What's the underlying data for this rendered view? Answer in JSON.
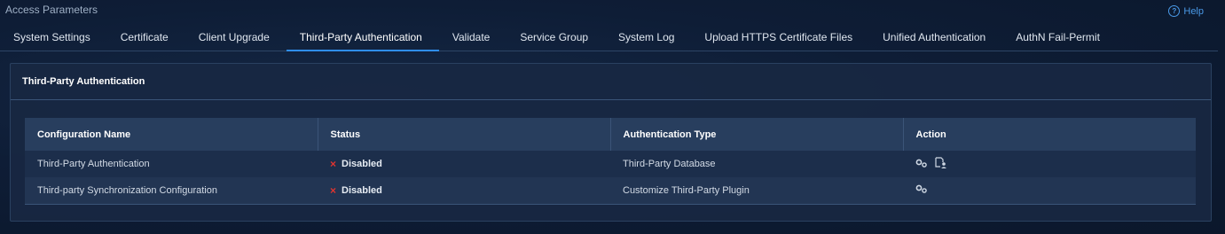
{
  "page": {
    "title": "Access Parameters",
    "help_label": "Help",
    "help_icon_glyph": "?"
  },
  "tabs": [
    {
      "label": "System Settings"
    },
    {
      "label": "Certificate"
    },
    {
      "label": "Client Upgrade"
    },
    {
      "label": "Third-Party Authentication",
      "active": true
    },
    {
      "label": "Validate"
    },
    {
      "label": "Service Group"
    },
    {
      "label": "System Log"
    },
    {
      "label": "Upload HTTPS Certificate Files"
    },
    {
      "label": "Unified Authentication"
    },
    {
      "label": "AuthN Fail-Permit"
    }
  ],
  "panel": {
    "title": "Third-Party Authentication"
  },
  "table": {
    "headers": [
      "Configuration Name",
      "Status",
      "Authentication Type",
      "Action"
    ],
    "rows": [
      {
        "name": "Third-Party Authentication",
        "status_icon": "×",
        "status": "Disabled",
        "auth_type": "Third-Party Database",
        "actions": [
          "settings-icon",
          "user-import-icon"
        ]
      },
      {
        "name": "Third-party Synchronization Configuration",
        "status_icon": "×",
        "status": "Disabled",
        "auth_type": "Customize Third-Party Plugin",
        "actions": [
          "settings-icon"
        ]
      }
    ]
  },
  "colors": {
    "accent": "#2f8ef0",
    "disabled": "#e0342f",
    "help": "#4a9ae8"
  }
}
